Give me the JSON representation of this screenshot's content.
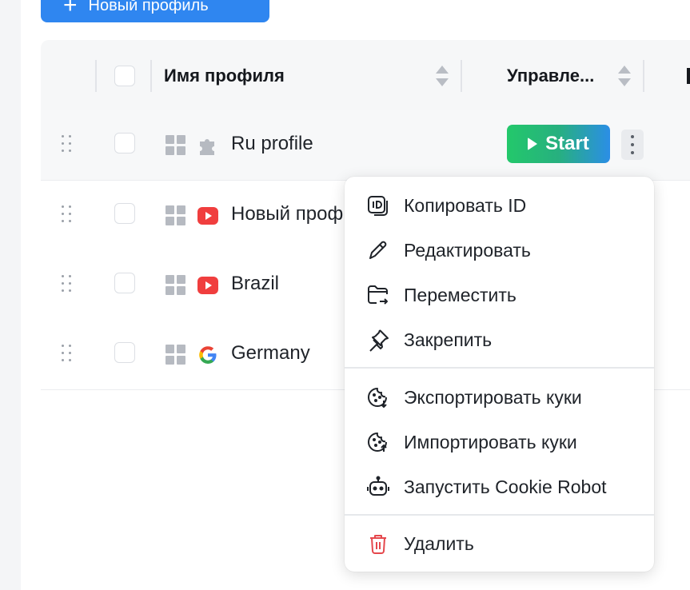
{
  "toolbar": {
    "new_profile_label": "Новый профиль",
    "new_profile_icon": "plus-icon"
  },
  "table": {
    "columns": {
      "name": "Имя профиля",
      "control": "Управле..."
    },
    "rows": [
      {
        "name": "Ru profile",
        "icon": "puzzle-icon"
      },
      {
        "name": "Новый проф",
        "icon": "youtube-icon"
      },
      {
        "name": "Brazil",
        "icon": "youtube-icon"
      },
      {
        "name": "Germany",
        "icon": "google-icon"
      }
    ],
    "start_label": "Start"
  },
  "context_menu": {
    "items": [
      {
        "label": "Копировать ID",
        "icon": "id-icon"
      },
      {
        "label": "Редактировать",
        "icon": "pencil-icon"
      },
      {
        "label": "Переместить",
        "icon": "folder-move-icon"
      },
      {
        "label": "Закрепить",
        "icon": "pin-icon"
      },
      {
        "label": "Экспортировать куки",
        "icon": "cookie-export-icon"
      },
      {
        "label": "Импортировать куки",
        "icon": "cookie-import-icon"
      },
      {
        "label": "Запустить Cookie Robot",
        "icon": "robot-icon"
      },
      {
        "label": "Удалить",
        "icon": "trash-icon"
      }
    ]
  },
  "colors": {
    "accent": "#2f86f0",
    "start_green": "#23c86b",
    "danger": "#e5484d",
    "youtube": "#f03e3e"
  }
}
